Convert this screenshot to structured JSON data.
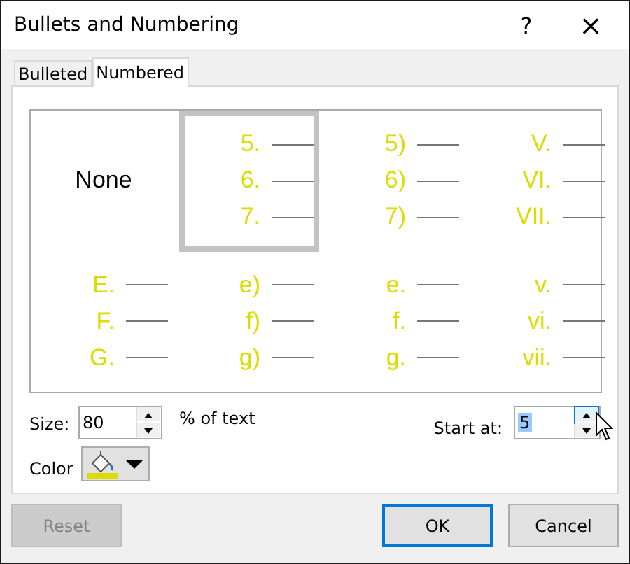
{
  "window": {
    "title": "Bullets and Numbering",
    "help": "?",
    "close": "×"
  },
  "tabs": [
    {
      "label": "Bulleted",
      "selected": false
    },
    {
      "label": "Numbered",
      "selected": true
    }
  ],
  "gallery": [
    {
      "kind": "none",
      "label": "None",
      "selected": false
    },
    {
      "kind": "list",
      "items": [
        "5.",
        "6.",
        "7."
      ],
      "selected": true
    },
    {
      "kind": "list",
      "items": [
        "5)",
        "6)",
        "7)"
      ],
      "selected": false
    },
    {
      "kind": "list",
      "items": [
        "V.",
        "VI.",
        "VII."
      ],
      "selected": false
    },
    {
      "kind": "list",
      "items": [
        "E.",
        "F.",
        "G."
      ],
      "selected": false
    },
    {
      "kind": "list",
      "items": [
        "e)",
        "f)",
        "g)"
      ],
      "selected": false
    },
    {
      "kind": "list",
      "items": [
        "e.",
        "f.",
        "g."
      ],
      "selected": false
    },
    {
      "kind": "list",
      "items": [
        "v.",
        "vi.",
        "vii."
      ],
      "selected": false
    }
  ],
  "size": {
    "label": "Size:",
    "value": "80",
    "unit": "% of text"
  },
  "start_at": {
    "label": "Start at:",
    "value": "5",
    "value_selected": true
  },
  "color": {
    "label": "Color",
    "color": "#dcdc00"
  },
  "buttons": [
    {
      "label": "Reset",
      "disabled": true,
      "default": false
    },
    {
      "label": "OK",
      "disabled": false,
      "default": true
    },
    {
      "label": "Cancel",
      "disabled": false,
      "default": false
    }
  ]
}
